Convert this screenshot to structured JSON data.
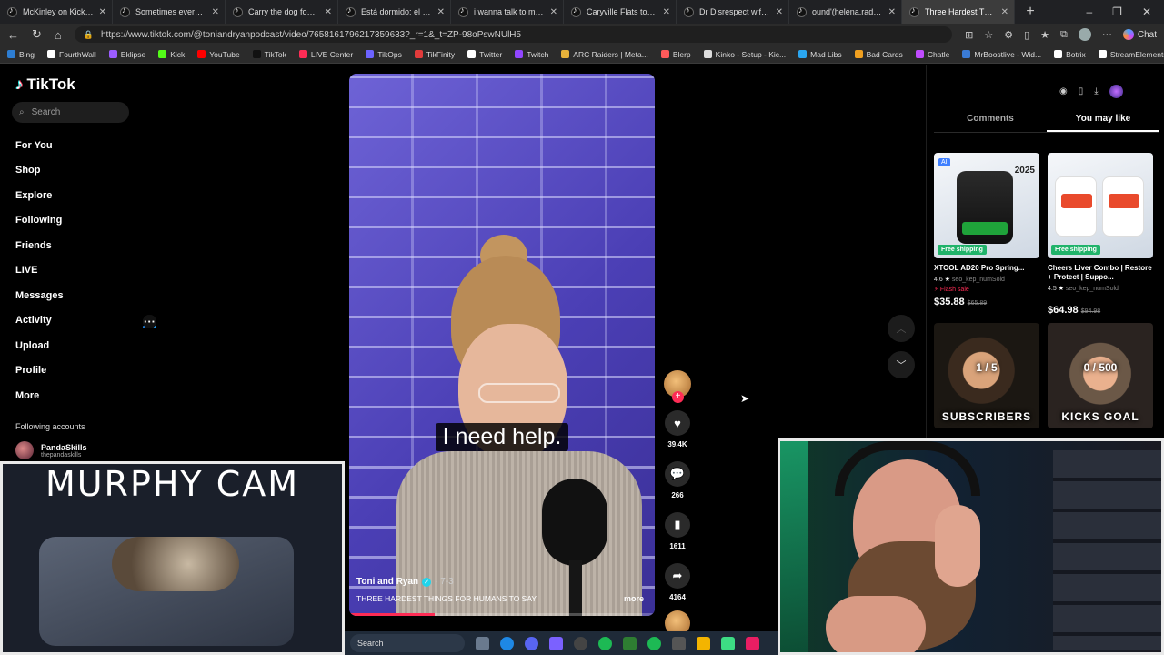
{
  "browser": {
    "tabs": [
      {
        "title": "McKinley on Kick (@mckin",
        "active": false
      },
      {
        "title": "Sometimes everything fee",
        "active": false
      },
      {
        "title": "Carry the dog food for a v",
        "active": false
      },
      {
        "title": "Está dormido: el señor de",
        "active": false
      },
      {
        "title": "i wanna talk to my lawy. llr",
        "active": false
      },
      {
        "title": "Caryville Flats to Home Tra",
        "active": false
      },
      {
        "title": "Dr Disrespect wife disresp",
        "active": false
      },
      {
        "title": "ound'(helena.radm@) Lilla",
        "active": false
      },
      {
        "title": "Three Hardest Things for H",
        "active": true
      }
    ],
    "new_tab": "+",
    "window_controls": [
      "–",
      "❐",
      "✕"
    ],
    "url": "https://www.tiktok.com/@toniandryanpodcast/video/7658161796217359633?_r=1&_t=ZP-98oPswNUlH5",
    "chat_label": "Chat",
    "bookmarks": [
      {
        "label": "Bing",
        "color": "#2d7dd2"
      },
      {
        "label": "FourthWall",
        "color": "#ffffff"
      },
      {
        "label": "Eklipse",
        "color": "#9b5cff"
      },
      {
        "label": "Kick",
        "color": "#53fc18"
      },
      {
        "label": "YouTube",
        "color": "#ff0000"
      },
      {
        "label": "TikTok",
        "color": "#111111"
      },
      {
        "label": "LIVE Center",
        "color": "#fe2c55"
      },
      {
        "label": "TikOps",
        "color": "#6c63ff"
      },
      {
        "label": "TikFinity",
        "color": "#e23b3b"
      },
      {
        "label": "Twitter",
        "color": "#ffffff"
      },
      {
        "label": "Twitch",
        "color": "#9146ff"
      },
      {
        "label": "ARC Raiders | Meta...",
        "color": "#e8b23a"
      },
      {
        "label": "Blerp",
        "color": "#ff5a5a"
      },
      {
        "label": "Kinko - Setup - Kic...",
        "color": "#dddddd"
      },
      {
        "label": "Mad Libs",
        "color": "#2aa6f0"
      },
      {
        "label": "Bad Cards",
        "color": "#f0a020"
      },
      {
        "label": "Chatle",
        "color": "#c04cff"
      },
      {
        "label": "MrBoostlive - Wid...",
        "color": "#3a7bd5"
      },
      {
        "label": "Botrix",
        "color": "#ffffff"
      },
      {
        "label": "StreamElements",
        "color": "#ffffff"
      }
    ]
  },
  "tiktok": {
    "logo": "TikTok",
    "search_placeholder": "Search",
    "menu": [
      {
        "label": "For You",
        "icon": "home-icon",
        "glyph": "⌂"
      },
      {
        "label": "Shop",
        "icon": "shop-icon",
        "glyph": "🛍"
      },
      {
        "label": "Explore",
        "icon": "compass-icon",
        "glyph": "◎"
      },
      {
        "label": "Following",
        "icon": "following-avatar-icon",
        "glyph": "●"
      },
      {
        "label": "Friends",
        "icon": "friends-icon",
        "glyph": "👥"
      },
      {
        "label": "LIVE",
        "icon": "live-avatar-icon",
        "glyph": "●"
      },
      {
        "label": "Messages",
        "icon": "messages-icon",
        "glyph": "▽"
      },
      {
        "label": "Activity",
        "icon": "activity-icon",
        "glyph": "☐"
      },
      {
        "label": "Upload",
        "icon": "upload-icon",
        "glyph": "⊕"
      },
      {
        "label": "Profile",
        "icon": "profile-avatar-icon",
        "glyph": "●"
      },
      {
        "label": "More",
        "icon": "more-icon",
        "glyph": "···"
      }
    ],
    "following_accounts_label": "Following accounts",
    "following_account": {
      "name": "PandaSkills",
      "handle": "thepandaskills"
    },
    "video": {
      "caption": "I need help.",
      "author": "Toni and Ryan",
      "date": "· 7-3",
      "description": "THREE HARDEST THINGS FOR HUMANS TO SAY",
      "more": "more",
      "progress": 0.28
    },
    "actions": {
      "likes": "39.4K",
      "comments": "266",
      "saves": "1611",
      "shares": "4164"
    },
    "right_panel": {
      "tabs": [
        "Comments",
        "You may like"
      ],
      "active_tab": "You may like",
      "products": [
        {
          "name": "XTOOL AD20 Pro Spring...",
          "rating": "4.6",
          "sold": "seo_kep_numSold",
          "flash": "Flash sale",
          "price": "$35.88",
          "old_price": "$65.89",
          "badge": "Free shipping",
          "year": "2025",
          "ai": "AI"
        },
        {
          "name": "Cheers Liver Combo | Restore + Protect | Suppo...",
          "rating": "4.5",
          "sold": "seo_kep_numSold",
          "price": "$64.98",
          "old_price": "$94.98",
          "badge": "Free shipping"
        }
      ],
      "videos": [
        {
          "top_text": "1 / 5",
          "bottom_text": "SUBSCRIBERS"
        },
        {
          "top_text": "0 / 500",
          "bottom_text": "KICKS GOAL"
        }
      ]
    }
  },
  "overlays": {
    "murphy_cam_title": "MURPHY CAM"
  },
  "taskbar": {
    "search_label": "Search"
  }
}
